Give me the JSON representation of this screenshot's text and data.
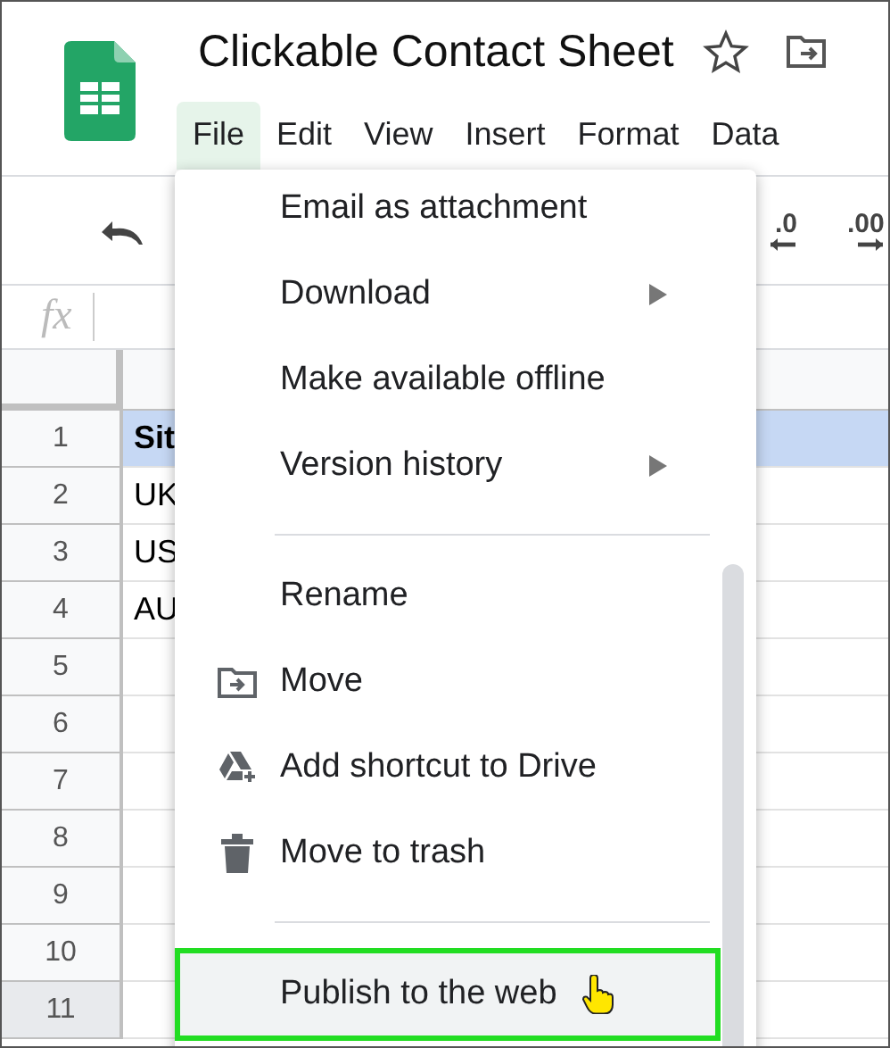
{
  "title": "Clickable Contact Sheet",
  "menu_bar": [
    {
      "label": "File",
      "selected": true
    },
    {
      "label": "Edit",
      "selected": false
    },
    {
      "label": "View",
      "selected": false
    },
    {
      "label": "Insert",
      "selected": false
    },
    {
      "label": "Format",
      "selected": false
    },
    {
      "label": "Data",
      "selected": false
    }
  ],
  "toolbar": [
    {
      "kind": "undo"
    },
    {
      "kind": "decrease-decimal",
      "label": ".0"
    },
    {
      "kind": "increase-decimal",
      "label": ".00"
    }
  ],
  "formula_bar": {
    "label": "fx"
  },
  "rows": [
    {
      "number": "1",
      "cell": "Sit",
      "selected": true,
      "hovered": false
    },
    {
      "number": "2",
      "cell": "UK",
      "selected": false,
      "hovered": false
    },
    {
      "number": "3",
      "cell": "US",
      "selected": false,
      "hovered": false
    },
    {
      "number": "4",
      "cell": "AU",
      "selected": false,
      "hovered": false
    },
    {
      "number": "5",
      "selected": false,
      "hovered": false
    },
    {
      "number": "6",
      "selected": false,
      "hovered": false
    },
    {
      "number": "7",
      "selected": false,
      "hovered": false
    },
    {
      "number": "8",
      "selected": false,
      "hovered": false
    },
    {
      "number": "9",
      "selected": false,
      "hovered": false
    },
    {
      "number": "10",
      "selected": false,
      "hovered": false
    },
    {
      "number": "11",
      "selected": false,
      "hovered": true
    }
  ],
  "file_menu": {
    "items": [
      {
        "kind": "item",
        "label": "Email as attachment",
        "submenu": false,
        "selected": false
      },
      {
        "kind": "item",
        "label": "Download",
        "submenu": true,
        "selected": false
      },
      {
        "kind": "item",
        "label": "Make available offline",
        "submenu": false,
        "selected": false
      },
      {
        "kind": "item",
        "label": "Version history",
        "submenu": true,
        "selected": false
      },
      {
        "kind": "separator"
      },
      {
        "kind": "item",
        "label": "Rename",
        "submenu": false,
        "selected": false
      },
      {
        "kind": "folder",
        "label": "Move",
        "submenu": false,
        "selected": false
      },
      {
        "kind": "drive",
        "label": "Add shortcut to Drive",
        "submenu": false,
        "selected": false
      },
      {
        "kind": "trash",
        "label": "Move to trash",
        "submenu": false,
        "selected": false
      },
      {
        "kind": "separator"
      },
      {
        "kind": "item",
        "label": "Publish to the web",
        "submenu": false,
        "selected": true
      }
    ]
  }
}
